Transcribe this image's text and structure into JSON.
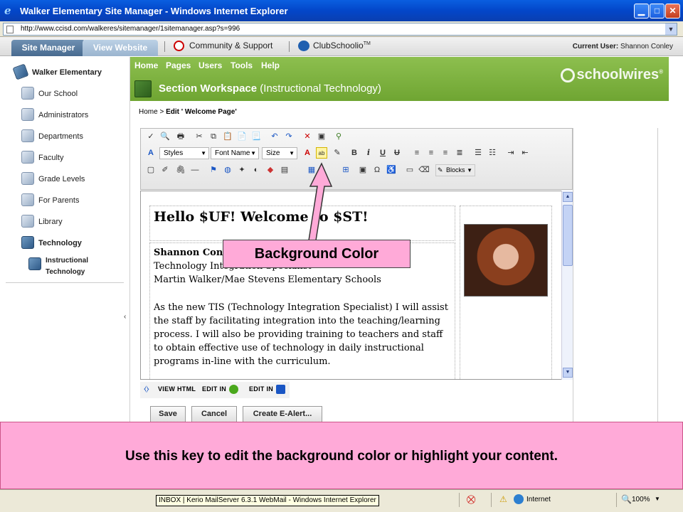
{
  "window": {
    "title": "Walker Elementary Site Manager - Windows Internet Explorer",
    "address": "http://www.ccisd.com/walkeres/sitemanager/1sitemanager.asp?s=996"
  },
  "nav": {
    "tab_site_manager": "Site Manager",
    "tab_view_website": "View Website",
    "community": "Community & Support",
    "clubschoolio": "ClubSchoolio",
    "clubschoolio_tm": "TM",
    "current_user_label": "Current User:",
    "current_user": "Shannon Conley"
  },
  "sidebar": {
    "school": "Walker Elementary",
    "items": [
      "Our School",
      "Administrators",
      "Departments",
      "Faculty",
      "Grade Levels",
      "For Parents",
      "Library",
      "Technology"
    ],
    "sub_item_line1": "Instructional",
    "sub_item_line2": "Technology"
  },
  "header": {
    "menu": [
      "Home",
      "Pages",
      "Users",
      "Tools",
      "Help"
    ],
    "workspace": "Section Workspace",
    "workspace_sub": "(Instructional Technology)",
    "logo": "schoolwires",
    "logo_mark": "®"
  },
  "breadcrumb": {
    "home": "Home",
    "sep": ">",
    "current": "Edit ' Welcome Page'"
  },
  "toolbar": {
    "styles": "Styles",
    "font_name": "Font Name",
    "size": "Size",
    "blocks": "Blocks"
  },
  "editor": {
    "heading": "Hello $UF! Welcome to $ST!",
    "name": "Shannon Conley",
    "role": "Technology Integration Specialist",
    "schools": "Martin Walker/Mae Stevens Elementary Schools",
    "paragraph": [
      "As the new TIS (Technology Integration Specialist) I will assist",
      "the staff by facilitating integration into the teaching/learning",
      "process. I will also be providing training to teachers and staff",
      "to obtain effective use of technology in daily instructional",
      "programs in-line with the curriculum."
    ]
  },
  "edit_modes": {
    "view_html": "VIEW HTML",
    "edit_in_1": "EDIT IN",
    "edit_in_2": "EDIT IN"
  },
  "actions": {
    "save": "Save",
    "cancel": "Cancel",
    "create_alert": "Create E-Alert..."
  },
  "annotation": {
    "callout": "Background Color",
    "banner": "Use this key to edit the background color or highlight your content."
  },
  "statusbar": {
    "taskbar_tip": "INBOX | Kerio MailServer 6.3.1 WebMail - Windows Internet Explorer",
    "zone": "Internet",
    "zoom": "100%"
  },
  "colors": {
    "callout_bg": "#ffaad8",
    "header_green": "#7fb241",
    "title_blue": "#0346c9"
  }
}
